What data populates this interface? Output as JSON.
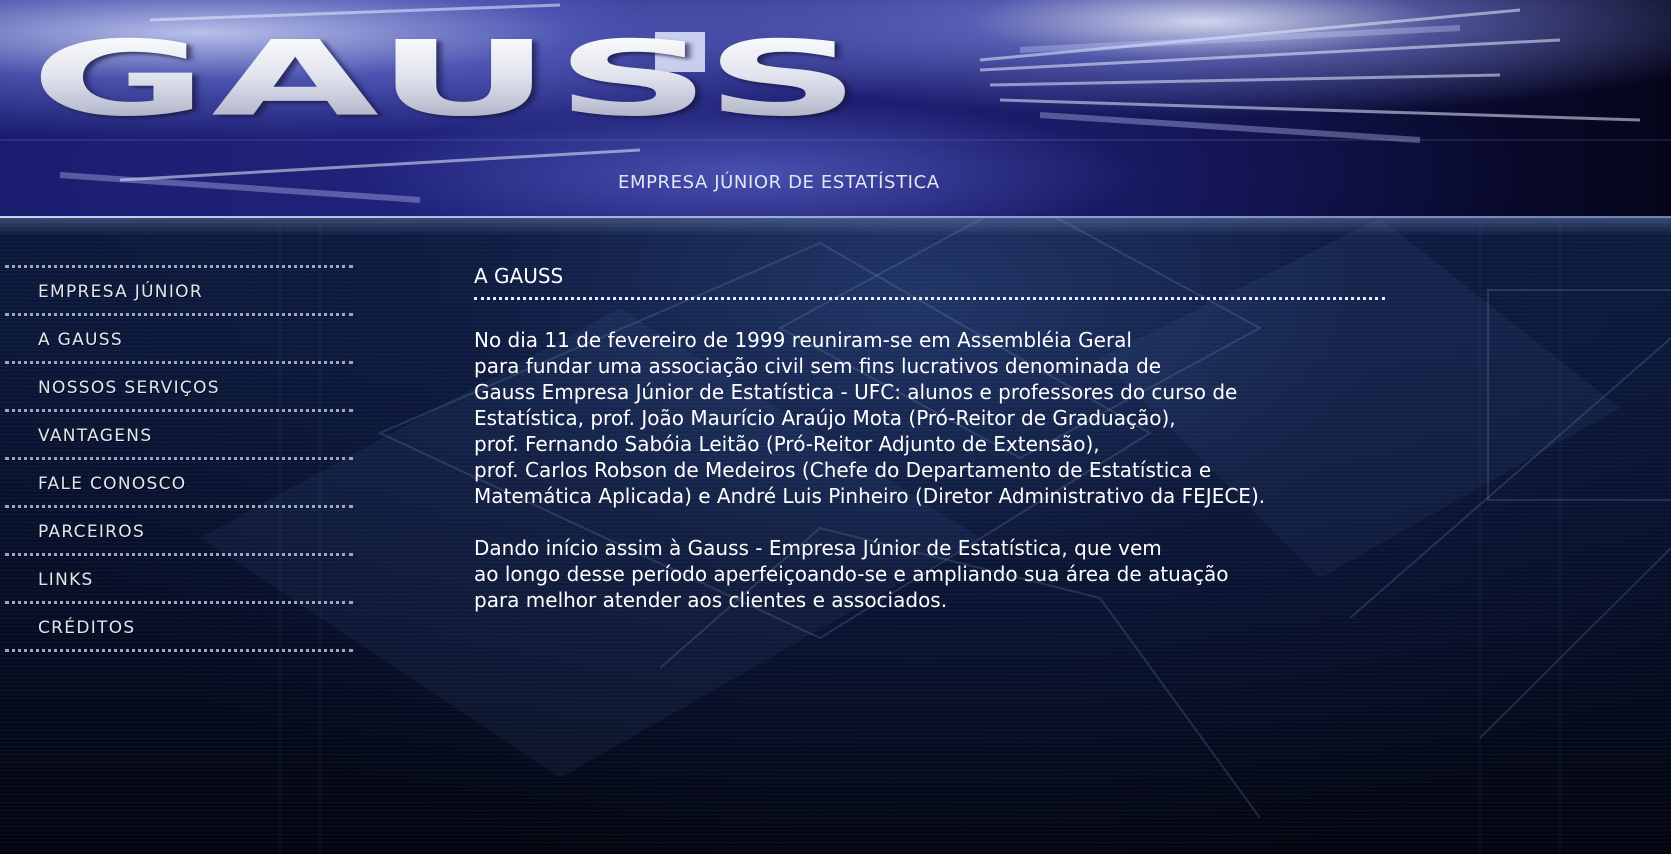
{
  "header": {
    "logo_text": "GAUSS",
    "subtitle": "EMPRESA JÚNIOR DE ESTATÍSTICA"
  },
  "sidebar": {
    "items": [
      {
        "label": "EMPRESA JÚNIOR"
      },
      {
        "label": "A GAUSS"
      },
      {
        "label": "NOSSOS SERVIÇOS"
      },
      {
        "label": "VANTAGENS"
      },
      {
        "label": "FALE CONOSCO"
      },
      {
        "label": "PARCEIROS"
      },
      {
        "label": "LINKS"
      },
      {
        "label": "CRÉDITOS"
      }
    ]
  },
  "main": {
    "title": "A GAUSS",
    "paragraphs": [
      "No dia 11 de fevereiro de 1999 reuniram-se em Assembléia Geral\npara fundar uma associação civil sem fins lucrativos denominada de\nGauss Empresa Júnior de Estatística - UFC: alunos e professores do curso de\nEstatística, prof. João Maurício Araújo Mota (Pró-Reitor de Graduação),\nprof. Fernando Sabóia Leitão (Pró-Reitor Adjunto de Extensão),\nprof. Carlos Robson de Medeiros (Chefe do Departamento de Estatística e\nMatemática Aplicada) e André Luis Pinheiro (Diretor Administrativo da FEJECE).",
      "Dando início assim à Gauss - Empresa Júnior de Estatística, que vem\nao longo desse período aperfeiçoando-se e ampliando sua área de atuação\npara melhor atender aos clientes e associados."
    ]
  },
  "colors": {
    "background": "#0b1736",
    "banner": "#23277e",
    "text": "#ffffff",
    "nav_text": "#e3e6ef"
  }
}
